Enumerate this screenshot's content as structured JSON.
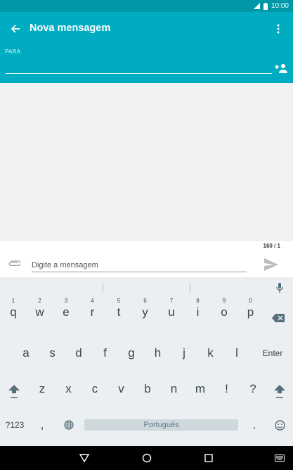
{
  "status_bar": {
    "time": "10:00"
  },
  "app_bar": {
    "title": "Nova mensagem",
    "to_label": "PARA",
    "to_value": ""
  },
  "compose": {
    "char_count": "160 / 1",
    "placeholder": "Digite a mensagem",
    "value": ""
  },
  "keyboard": {
    "row1": [
      {
        "k": "q",
        "h": "1"
      },
      {
        "k": "w",
        "h": "2"
      },
      {
        "k": "e",
        "h": "3"
      },
      {
        "k": "r",
        "h": "4"
      },
      {
        "k": "t",
        "h": "5"
      },
      {
        "k": "y",
        "h": "6"
      },
      {
        "k": "u",
        "h": "7"
      },
      {
        "k": "i",
        "h": "8"
      },
      {
        "k": "o",
        "h": "9"
      },
      {
        "k": "p",
        "h": "0"
      }
    ],
    "row2": [
      "a",
      "s",
      "d",
      "f",
      "g",
      "h",
      "j",
      "k",
      "l"
    ],
    "enter_label": "Enter",
    "row3": [
      "z",
      "x",
      "c",
      "v",
      "b",
      "n",
      "m",
      "!",
      "?"
    ],
    "symbols_label": "?123",
    "comma": ",",
    "space_label": "Português",
    "period": "."
  },
  "colors": {
    "status_bar": "#0097a7",
    "app_bar": "#00acc1",
    "keyboard_bg": "#eceff1"
  },
  "icons": {
    "back": "arrow-back-icon",
    "menu": "more-vert-icon",
    "add_contact": "person-add-icon",
    "attach": "paperclip-icon",
    "send": "send-icon",
    "mic": "mic-icon",
    "backspace": "backspace-icon",
    "shift": "shift-icon",
    "globe": "globe-icon",
    "emoji": "emoji-icon"
  }
}
